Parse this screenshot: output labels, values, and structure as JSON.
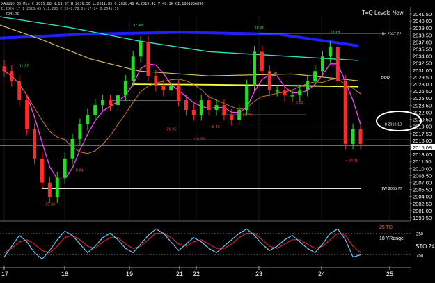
{
  "header": {
    "symbol_info": "XAUUSD 30 Min  C:2015.08  N:13.87  H:2036.56  L:2011.85  O:2028.48  A:2015.42  V:48.1K  OI:1861956896",
    "subline": "D:2024 17 1  2020.43  V:1.283  C:2041.78  01-17-24  D:2541.78",
    "top_price_label": "2041.78",
    "overlay_title": "T=Q Levels New"
  },
  "chart_data": [
    {
      "type": "line",
      "title": "T=Q Levels New",
      "x": [
        "17",
        "18",
        "19",
        "21",
        "22",
        "23",
        "24",
        "25"
      ],
      "y_ticks": [
        "2041.50",
        "2040.00",
        "2039.00",
        "2038.50",
        "2037.00",
        "2035.50",
        "2034.00",
        "2032.50",
        "2031.00",
        "2029.50",
        "2028.00",
        "2026.50",
        "2025.00",
        "2023.50",
        "2022.00",
        "2020.50",
        "2019.00",
        "2017.50",
        "2016.00",
        "2015.08",
        "2013.00",
        "2011.50",
        "2010.00",
        "2008.50",
        "2007.00",
        "2005.50",
        "2004.00",
        "2002.50",
        "2001.00",
        "1999.50"
      ],
      "current_price": "2015.08",
      "ylim": [
        1999.5,
        2041.5
      ],
      "price_series": [
        2030,
        2028,
        2024,
        2018,
        2012,
        2007,
        2004,
        2008,
        2012,
        2016,
        2019,
        2021,
        2023,
        2024,
        2023,
        2025,
        2028,
        2033,
        2036,
        2029,
        2027,
        2026,
        2027,
        2024,
        2022,
        2021,
        2024,
        2022,
        2023,
        2021,
        2020,
        2022,
        2027,
        2034,
        2030,
        2026,
        2026,
        2025,
        2025,
        2026,
        2028,
        2030,
        2033,
        2035,
        2028,
        2015,
        2018,
        2015
      ],
      "series": [
        {
          "name": "fast MA",
          "color": "#ff40ff"
        },
        {
          "name": "medium MA",
          "color": "#30e0c0"
        },
        {
          "name": "slow MA",
          "color": "#d4c060"
        },
        {
          "name": "long MA",
          "color": "#2020ff"
        },
        {
          "name": "level",
          "color": "#ffff40"
        }
      ],
      "annotations": [
        {
          "text": "11 32",
          "x_index": 2,
          "y": 2030.8,
          "color": "#40ff40"
        },
        {
          "text": "37 43",
          "x_index": 17,
          "y": 2039.2,
          "color": "#40ff40"
        },
        {
          "text": "18 21",
          "x_index": 33,
          "y": 2038.6,
          "color": "#40ff40"
        },
        {
          "text": "13 18",
          "x_index": 43,
          "y": 2037.8,
          "color": "#40ff40"
        },
        {
          "text": "~ 25 33",
          "x_index": 5,
          "y": 2002.3,
          "color": "#ff4040"
        },
        {
          "text": "~ 20 25",
          "x_index": 21,
          "y": 2017.8,
          "color": "#ff4040"
        },
        {
          "text": "~ 8 40",
          "x_index": 27,
          "y": 2018.3,
          "color": "#ff4040"
        },
        {
          "text": "~ 19 42",
          "x_index": 31,
          "y": 2020.8,
          "color": "#ff4040"
        },
        {
          "text": "~ 6 18",
          "x_index": 38,
          "y": 2023.3,
          "color": "#ff4040"
        },
        {
          "text": "~ 24 11",
          "x_index": 45,
          "y": 2011.3,
          "color": "#ff4040"
        },
        {
          "text": "~ 6 35",
          "x_index": 25,
          "y": 2015.8,
          "color": "#ff4040"
        },
        {
          "text": "5 30",
          "x_index": 35,
          "y": 2029.3,
          "color": "#40ff40"
        },
        {
          "text": "~ 8 24",
          "x_index": 9,
          "y": 2009.3,
          "color": "#ff4040"
        }
      ],
      "right_labels": [
        {
          "text": "1H 2037.72",
          "y": 2037.7
        },
        {
          "text": "RRR",
          "y": 2028.6
        },
        {
          "text": "~ 8 2019.10",
          "y": 2019.1
        },
        {
          "text": "1W 2005.77",
          "y": 2005.8
        }
      ]
    },
    {
      "type": "line",
      "title": "",
      "legend": [
        "25 TD",
        "18 YRange"
      ],
      "side_label": "STO 24",
      "y_ticks": [
        "250",
        "750"
      ],
      "ylim": [
        0,
        100
      ],
      "fast_series": [
        20,
        45,
        70,
        55,
        30,
        15,
        35,
        60,
        80,
        70,
        50,
        30,
        45,
        65,
        75,
        60,
        40,
        30,
        50,
        70,
        85,
        75,
        55,
        35,
        50,
        65,
        55,
        40,
        30,
        45,
        60,
        75,
        85,
        70,
        50,
        35,
        45,
        60,
        70,
        55,
        40,
        30,
        50,
        75,
        85,
        60,
        20,
        25
      ],
      "slow_series": [
        30,
        40,
        55,
        60,
        50,
        35,
        30,
        45,
        65,
        70,
        60,
        45,
        40,
        55,
        65,
        65,
        50,
        40,
        45,
        60,
        75,
        75,
        65,
        50,
        45,
        55,
        60,
        50,
        40,
        40,
        50,
        65,
        75,
        75,
        60,
        45,
        40,
        50,
        60,
        60,
        50,
        40,
        45,
        60,
        75,
        70,
        45,
        30
      ]
    }
  ]
}
